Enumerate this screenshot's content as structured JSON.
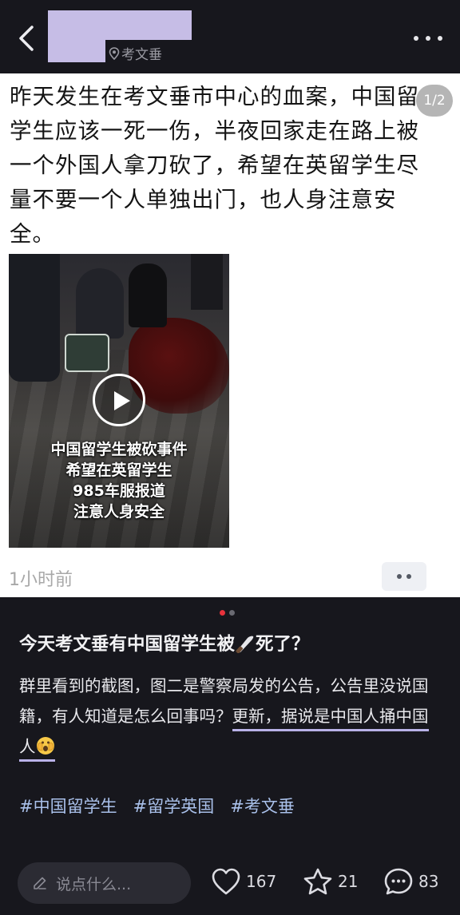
{
  "header": {
    "location": "考文垂"
  },
  "image_card": {
    "text": "昨天发生在考文垂市中心的血案，中国留学生应该一死一伤，半夜回家走在路上被一个外国人拿刀砍了，希望在英留学生尽量不要一个人单独出门，也人身注意安全。",
    "page_indicator": "1/2",
    "video_caption": [
      "中国留学生被砍事件",
      "希望在英留学生",
      "985车服报道",
      "注意人身安全"
    ],
    "timestamp": "1小时前"
  },
  "carousel": {
    "active_color": "#e8323c",
    "inactive_color": "#6a6a72"
  },
  "post": {
    "title_before": "今天考文垂有中国留学生被",
    "title_after": "死了？",
    "title_icon": "knife-emoji",
    "body_plain": "群里看到的截图，图二是警察局发的公告，公告里没说国籍，有人知道是怎么回事吗？",
    "body_highlight": "更新，据说是中国人捅中国人",
    "body_icon": "shocked-face-emoji",
    "tags": [
      "#中国留学生",
      "#留学英国",
      "#考文垂"
    ]
  },
  "bottom_bar": {
    "comment_placeholder": "说点什么...",
    "likes": "167",
    "favorites": "21",
    "comments": "83"
  },
  "colors": {
    "background": "#17171d",
    "tag": "#a9c0ea",
    "highlight_underline": "#b9b2e8"
  }
}
